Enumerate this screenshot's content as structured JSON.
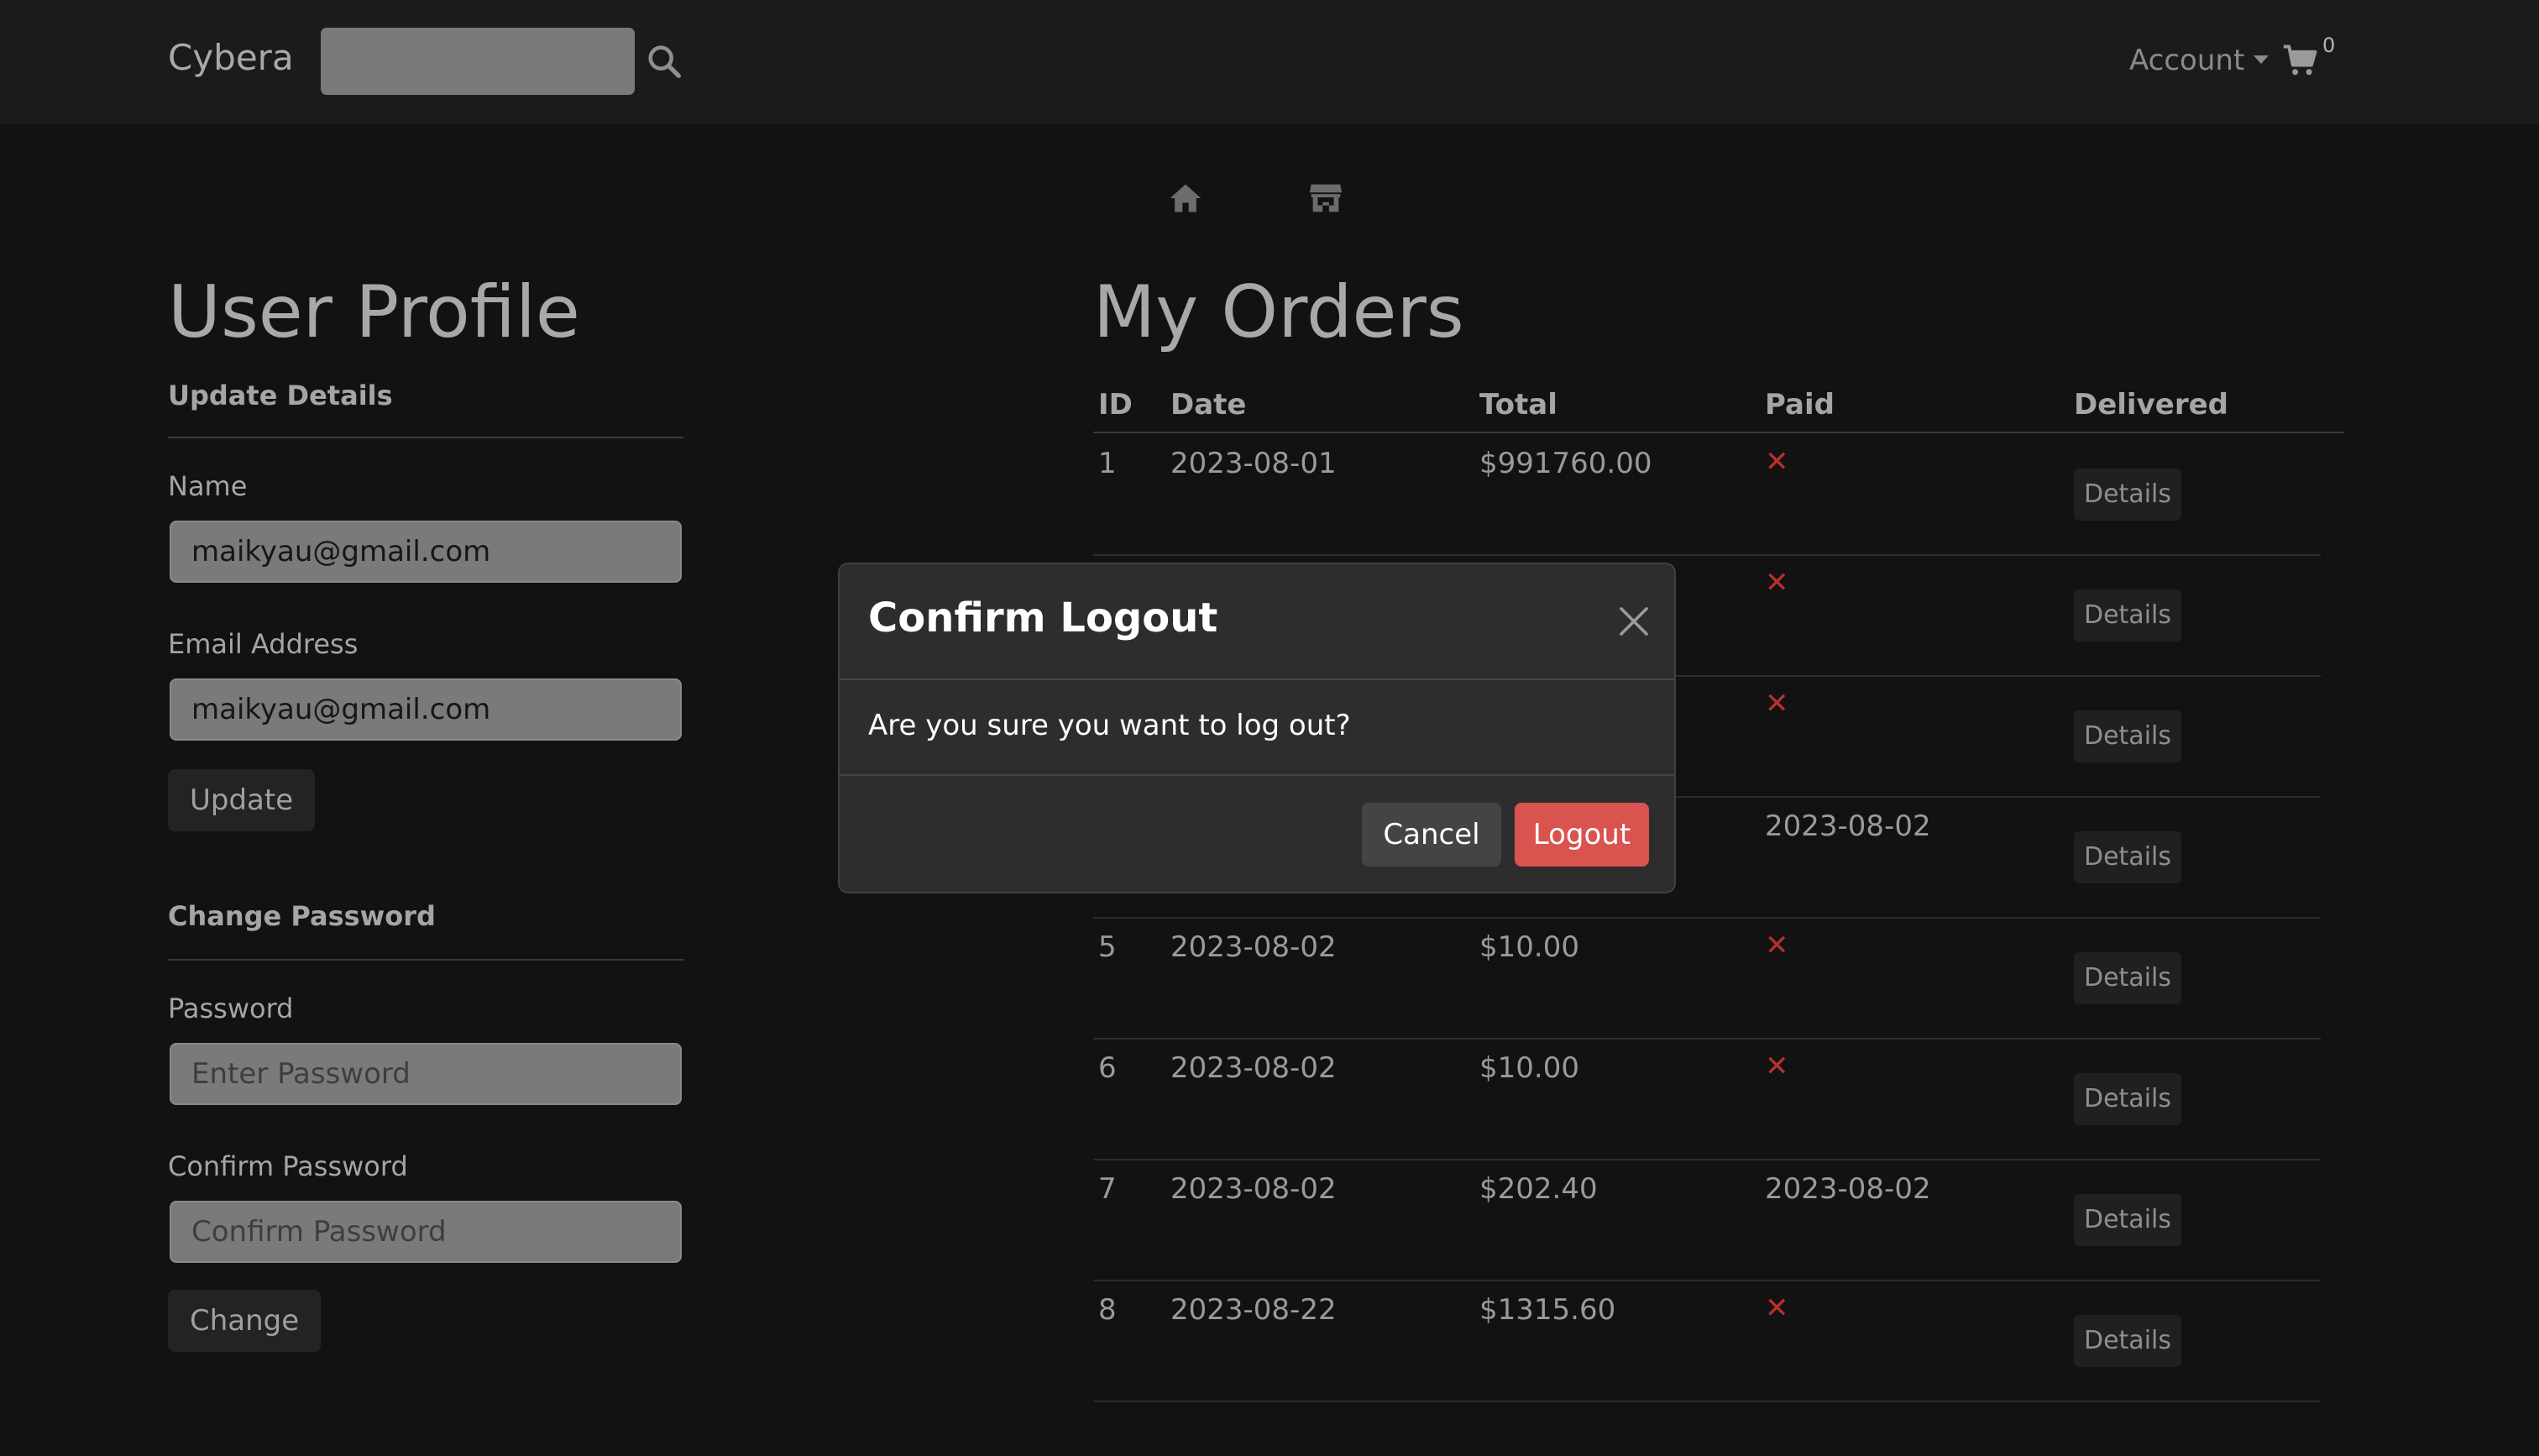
{
  "navbar": {
    "brand": "Cybera",
    "search_value": "",
    "account_label": "Account",
    "cart_count": "0"
  },
  "icons": {
    "search": "search-icon",
    "cart": "cart-icon",
    "home": "home-icon",
    "store": "store-icon",
    "close": "close-icon",
    "not_paid": "x-mark-icon"
  },
  "profile": {
    "title": "User Profile",
    "update_heading": "Update Details",
    "name_label": "Name",
    "name_value": "maikyau@gmail.com",
    "email_label": "Email Address",
    "email_value": "maikyau@gmail.com",
    "update_button": "Update",
    "password_heading": "Change Password",
    "password_label": "Password",
    "password_placeholder": "Enter Password",
    "confirm_label": "Confirm Password",
    "confirm_placeholder": "Confirm Password",
    "change_button": "Change"
  },
  "orders": {
    "title": "My Orders",
    "headers": [
      "ID",
      "Date",
      "Total",
      "Paid",
      "Delivered"
    ],
    "details_label": "Details",
    "not_paid_symbol": "✕",
    "rows": [
      {
        "id": "1",
        "date": "2023-08-01",
        "total": "$991760.00",
        "paid": ""
      },
      {
        "id": "",
        "date": "",
        "total": "",
        "paid": ""
      },
      {
        "id": "",
        "date": "",
        "total": "",
        "paid": ""
      },
      {
        "id": "",
        "date": "",
        "total": "",
        "paid": "2023-08-02"
      },
      {
        "id": "5",
        "date": "2023-08-02",
        "total": "$10.00",
        "paid": ""
      },
      {
        "id": "6",
        "date": "2023-08-02",
        "total": "$10.00",
        "paid": ""
      },
      {
        "id": "7",
        "date": "2023-08-02",
        "total": "$202.40",
        "paid": "2023-08-02"
      },
      {
        "id": "8",
        "date": "2023-08-22",
        "total": "$1315.60",
        "paid": ""
      }
    ]
  },
  "modal": {
    "title": "Confirm Logout",
    "body": "Are you sure you want to log out?",
    "cancel": "Cancel",
    "logout": "Logout"
  },
  "colors": {
    "background": "#121212",
    "navbar": "#1b1b1b",
    "danger": "#d9534f",
    "x_mark": "#b8302d"
  }
}
